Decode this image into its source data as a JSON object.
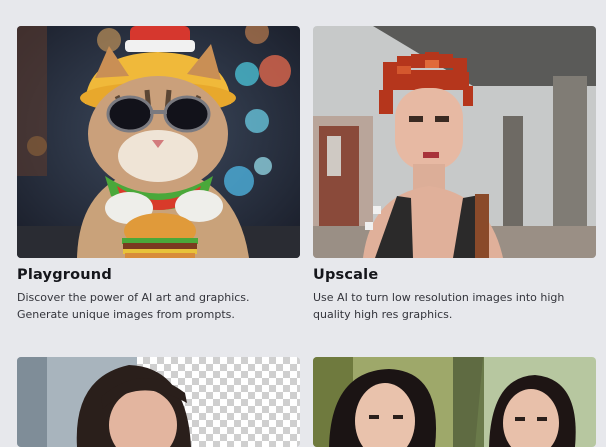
{
  "cards": [
    {
      "title": "Playground",
      "description": "Discover the power of AI art and graphics. Generate unique images from prompts.",
      "image": "cat-with-burger-image"
    },
    {
      "title": "Upscale",
      "description": "Use AI to turn low resolution images into high quality high res graphics.",
      "image": "pixelated-portrait-image"
    },
    {
      "title": "",
      "description": "",
      "image": "background-removal-portrait-image"
    },
    {
      "title": "",
      "description": "",
      "image": "face-swap-portraits-image"
    }
  ],
  "colors": {
    "page_background": "#e7e8ec",
    "title_text": "#15161b",
    "body_text": "#33343b"
  }
}
